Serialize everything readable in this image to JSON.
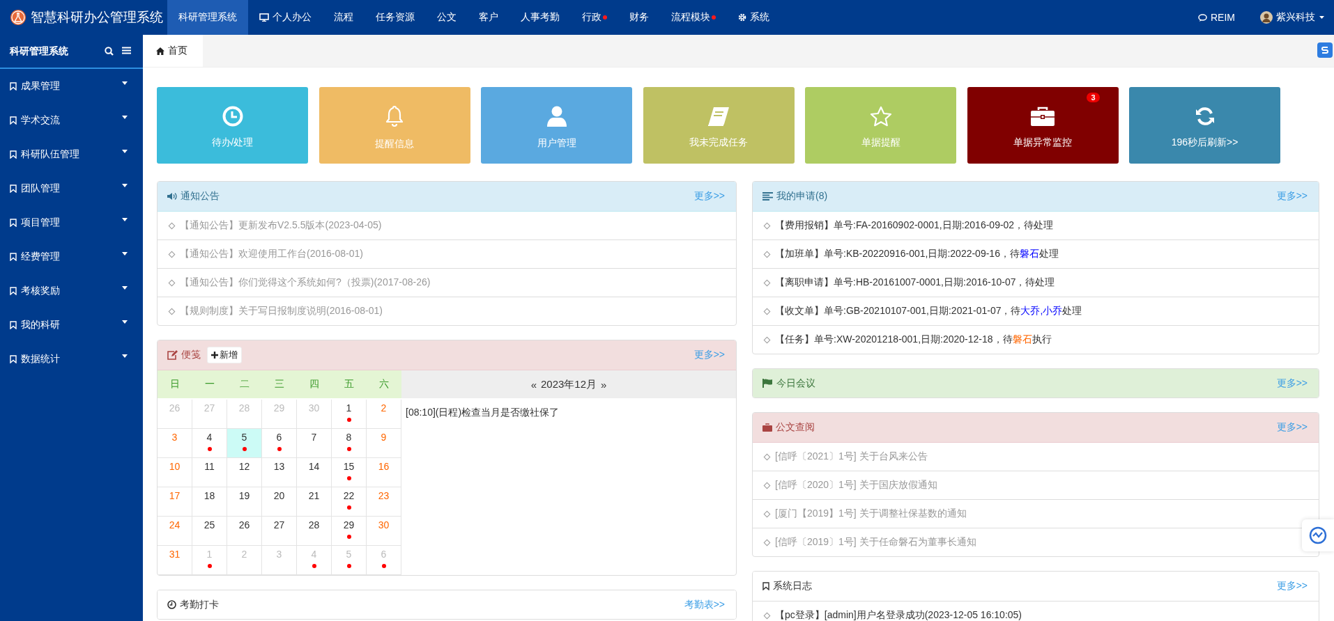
{
  "app": {
    "title": "智慧科研办公管理系统"
  },
  "top_nav": [
    {
      "label": "科研管理系统",
      "selected": true,
      "kind": "plain",
      "notice": false
    },
    {
      "label": "个人办公",
      "selected": false,
      "kind": "monitor",
      "notice": false
    },
    {
      "label": "流程",
      "selected": false,
      "kind": "plain",
      "notice": false
    },
    {
      "label": "任务资源",
      "selected": false,
      "kind": "plain",
      "notice": false
    },
    {
      "label": "公文",
      "selected": false,
      "kind": "plain",
      "notice": false
    },
    {
      "label": "客户",
      "selected": false,
      "kind": "plain",
      "notice": false
    },
    {
      "label": "人事考勤",
      "selected": false,
      "kind": "plain",
      "notice": false
    },
    {
      "label": "行政",
      "selected": false,
      "kind": "plain",
      "notice": true
    },
    {
      "label": "财务",
      "selected": false,
      "kind": "plain",
      "notice": false
    },
    {
      "label": "流程模块",
      "selected": false,
      "kind": "plain",
      "notice": true
    },
    {
      "label": "系统",
      "selected": false,
      "kind": "gear",
      "notice": false
    }
  ],
  "top_right": {
    "chat": "REIM",
    "user": "紫兴科技"
  },
  "sidebar": {
    "title": "科研管理系统",
    "items": [
      {
        "label": "成果管理"
      },
      {
        "label": "学术交流"
      },
      {
        "label": "科研队伍管理"
      },
      {
        "label": "团队管理"
      },
      {
        "label": "项目管理"
      },
      {
        "label": "经费管理"
      },
      {
        "label": "考核奖励"
      },
      {
        "label": "我的科研"
      },
      {
        "label": "数据统计"
      }
    ]
  },
  "tabs": [
    {
      "label": "首页",
      "selected": true
    }
  ],
  "tiles": [
    {
      "label": "待办/处理",
      "kind": "clock",
      "color": "#3bbcdb"
    },
    {
      "label": "提醒信息",
      "kind": "bell",
      "color": "#efbb64"
    },
    {
      "label": "用户管理",
      "kind": "user",
      "color": "#5aa9e0"
    },
    {
      "label": "我未完成任务",
      "kind": "book",
      "color": "#bfc163"
    },
    {
      "label": "单据提醒",
      "kind": "star",
      "color": "#aecc62"
    },
    {
      "label": "单据异常监控",
      "kind": "briefcase",
      "color": "#800000",
      "badge": "3"
    },
    {
      "label": "196秒后刷新>>",
      "kind": "refresh",
      "color": "#3a88ac"
    }
  ],
  "left_panels": [
    {
      "kind": "notices",
      "title": "通知公告",
      "more": "更多>>",
      "items": [
        {
          "parts": [
            {
              "text": "【通知公告】更新发布V2.5.5版本(2023-04-05)"
            }
          ]
        },
        {
          "parts": [
            {
              "text": "【通知公告】欢迎使用工作台(2016-08-01)"
            }
          ]
        },
        {
          "parts": [
            {
              "text": "【通知公告】你们觉得这个系统如何?（投票)(2017-08-26)"
            }
          ]
        },
        {
          "parts": [
            {
              "text": "【规则制度】关于写日报制度说明(2016-08-01)"
            }
          ]
        }
      ]
    },
    {
      "kind": "notes",
      "title": "便笺",
      "add": "新增",
      "more": "更多>>",
      "calendar": {
        "prev": "«",
        "month": "2023年12月",
        "next": "»",
        "weekdays": [
          "日",
          "一",
          "二",
          "三",
          "四",
          "五",
          "六"
        ],
        "weeks": [
          {
            "days": [
              {
                "day": "26",
                "kind": "other",
                "event": false,
                "selected": false
              },
              {
                "day": "27",
                "kind": "other",
                "event": false,
                "selected": false
              },
              {
                "day": "28",
                "kind": "other",
                "event": false,
                "selected": false
              },
              {
                "day": "29",
                "kind": "other",
                "event": false,
                "selected": false
              },
              {
                "day": "30",
                "kind": "other",
                "event": false,
                "selected": false
              },
              {
                "day": "1",
                "kind": "weekday",
                "event": true,
                "selected": false
              },
              {
                "day": "2",
                "kind": "weekend",
                "event": false,
                "selected": false
              }
            ]
          },
          {
            "days": [
              {
                "day": "3",
                "kind": "weekend",
                "event": false,
                "selected": false
              },
              {
                "day": "4",
                "kind": "weekday",
                "event": true,
                "selected": false
              },
              {
                "day": "5",
                "kind": "weekday",
                "event": true,
                "selected": true
              },
              {
                "day": "6",
                "kind": "weekday",
                "event": true,
                "selected": false
              },
              {
                "day": "7",
                "kind": "weekday",
                "event": false,
                "selected": false
              },
              {
                "day": "8",
                "kind": "weekday",
                "event": true,
                "selected": false
              },
              {
                "day": "9",
                "kind": "weekend",
                "event": false,
                "selected": false
              }
            ]
          },
          {
            "days": [
              {
                "day": "10",
                "kind": "weekend",
                "event": false,
                "selected": false
              },
              {
                "day": "11",
                "kind": "weekday",
                "event": false,
                "selected": false
              },
              {
                "day": "12",
                "kind": "weekday",
                "event": false,
                "selected": false
              },
              {
                "day": "13",
                "kind": "weekday",
                "event": false,
                "selected": false
              },
              {
                "day": "14",
                "kind": "weekday",
                "event": false,
                "selected": false
              },
              {
                "day": "15",
                "kind": "weekday",
                "event": true,
                "selected": false
              },
              {
                "day": "16",
                "kind": "weekend",
                "event": false,
                "selected": false
              }
            ]
          },
          {
            "days": [
              {
                "day": "17",
                "kind": "weekend",
                "event": false,
                "selected": false
              },
              {
                "day": "18",
                "kind": "weekday",
                "event": false,
                "selected": false
              },
              {
                "day": "19",
                "kind": "weekday",
                "event": false,
                "selected": false
              },
              {
                "day": "20",
                "kind": "weekday",
                "event": false,
                "selected": false
              },
              {
                "day": "21",
                "kind": "weekday",
                "event": false,
                "selected": false
              },
              {
                "day": "22",
                "kind": "weekday",
                "event": true,
                "selected": false
              },
              {
                "day": "23",
                "kind": "weekend",
                "event": false,
                "selected": false
              }
            ]
          },
          {
            "days": [
              {
                "day": "24",
                "kind": "weekend",
                "event": false,
                "selected": false
              },
              {
                "day": "25",
                "kind": "weekday",
                "event": false,
                "selected": false
              },
              {
                "day": "26",
                "kind": "weekday",
                "event": false,
                "selected": false
              },
              {
                "day": "27",
                "kind": "weekday",
                "event": false,
                "selected": false
              },
              {
                "day": "28",
                "kind": "weekday",
                "event": false,
                "selected": false
              },
              {
                "day": "29",
                "kind": "weekday",
                "event": true,
                "selected": false
              },
              {
                "day": "30",
                "kind": "weekend",
                "event": false,
                "selected": false
              }
            ]
          },
          {
            "days": [
              {
                "day": "31",
                "kind": "weekend",
                "event": false,
                "selected": false
              },
              {
                "day": "1",
                "kind": "other",
                "event": true,
                "selected": false
              },
              {
                "day": "2",
                "kind": "other",
                "event": false,
                "selected": false
              },
              {
                "day": "3",
                "kind": "other",
                "event": false,
                "selected": false
              },
              {
                "day": "4",
                "kind": "other",
                "event": true,
                "selected": false
              },
              {
                "day": "5",
                "kind": "other",
                "event": true,
                "selected": false
              },
              {
                "day": "6",
                "kind": "other",
                "event": true,
                "selected": false
              }
            ]
          }
        ],
        "entries": [
          "[08:10](日程)检查当月是否缴社保了"
        ]
      }
    },
    {
      "kind": "attendance",
      "title": "考勤打卡",
      "more": "考勤表>>"
    }
  ],
  "right_panels": [
    {
      "kind": "requests",
      "title": "我的申请(8)",
      "more": "更多>>",
      "items": [
        {
          "parts": [
            {
              "text": "【费用报销】单号:FA-20160902-0001,日期:2016-09-02，待处理"
            }
          ]
        },
        {
          "parts": [
            {
              "text": "【加班单】单号:KB-20220916-001,日期:2022-09-16，待"
            },
            {
              "text": "磐石",
              "color": "#0000ff"
            },
            {
              "text": "处理"
            }
          ]
        },
        {
          "parts": [
            {
              "text": "【离职申请】单号:HB-20161007-0001,日期:2016-10-07，待处理"
            }
          ]
        },
        {
          "parts": [
            {
              "text": "【收文单】单号:GB-20210107-001,日期:2021-01-07，待"
            },
            {
              "text": "大乔,小乔",
              "color": "#0000ff"
            },
            {
              "text": "处理"
            }
          ]
        },
        {
          "parts": [
            {
              "text": "【任务】单号:XW-20201218-001,日期:2020-12-18，待"
            },
            {
              "text": "磐石",
              "color": "#ff6600"
            },
            {
              "text": "执行"
            }
          ]
        }
      ]
    },
    {
      "kind": "meetings",
      "title": "今日会议",
      "more": "更多>>"
    },
    {
      "kind": "documents",
      "title": "公文查阅",
      "more": "更多>>",
      "items": [
        {
          "parts": [
            {
              "text": "[信呼〔2021〕1号] 关于台风来公告"
            }
          ]
        },
        {
          "parts": [
            {
              "text": "[信呼〔2020〕1号] 关于国庆放假通知"
            }
          ]
        },
        {
          "parts": [
            {
              "text": "[厦门【2019】1号] 关于调整社保基数的通知"
            }
          ]
        },
        {
          "parts": [
            {
              "text": "[信呼〔2019〕1号] 关于任命磐石为董事长通知"
            }
          ]
        }
      ]
    },
    {
      "kind": "logs",
      "title": "系统日志",
      "more": "更多>>",
      "items": [
        {
          "parts": [
            {
              "text": "【pc登录】[admin]用户名登录成功(2023-12-05 16:10:05)"
            }
          ]
        }
      ]
    }
  ]
}
